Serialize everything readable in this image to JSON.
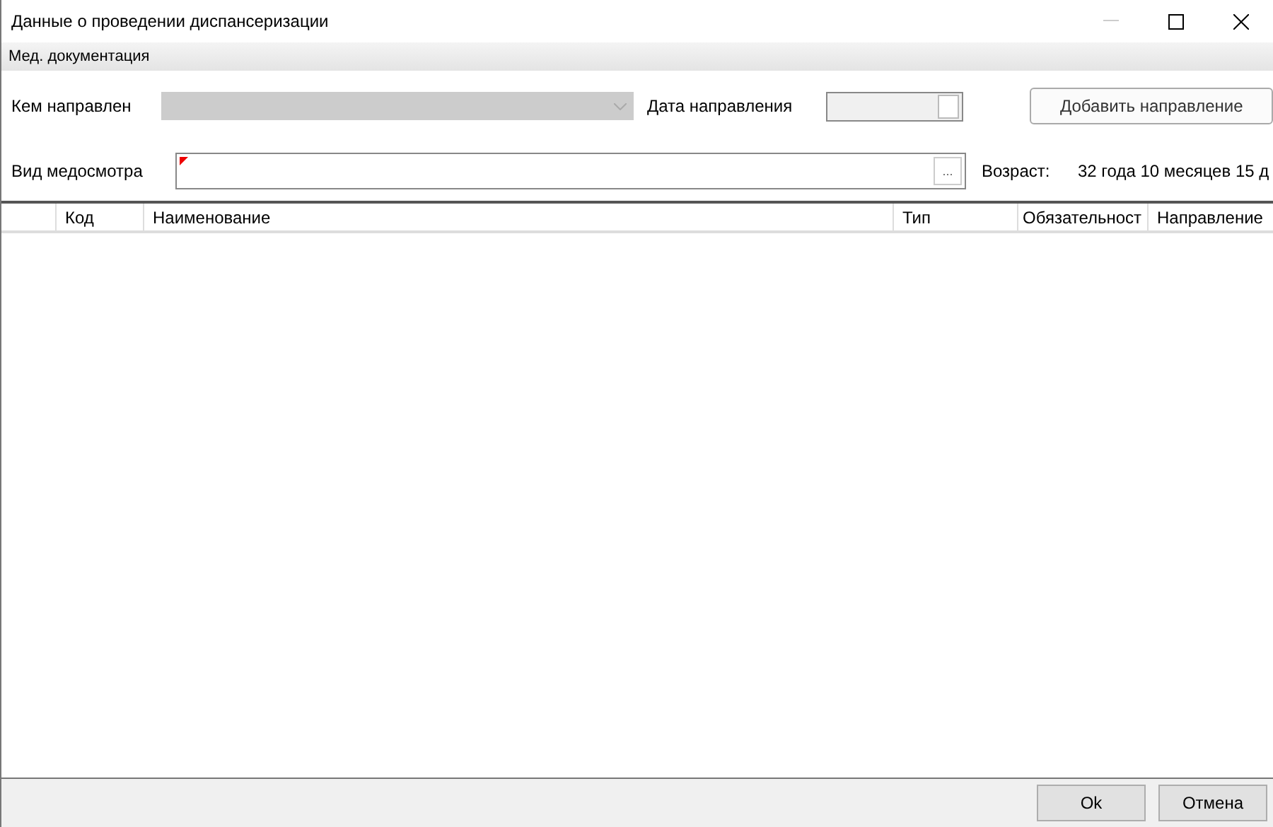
{
  "window": {
    "title": "Данные о проведении диспансеризации"
  },
  "section": {
    "title": "Мед. документация"
  },
  "form": {
    "referrer": {
      "label": "Кем направлен",
      "disabled": true
    },
    "date": {
      "label": "Дата направления",
      "disabled": true
    },
    "add_button": "Добавить направление",
    "exam_type": {
      "label": "Вид медосмотра",
      "required": true,
      "browse": "..."
    },
    "age": {
      "label": "Возраст:",
      "value": "32 года 10 месяцев 15 д"
    }
  },
  "table": {
    "columns": [
      {
        "label": "Код"
      },
      {
        "label": "Наименование"
      },
      {
        "label": "Тип"
      },
      {
        "label": "Обязательност"
      },
      {
        "label": "Направление"
      }
    ]
  },
  "buttons": [
    "Ok",
    "Отмена"
  ]
}
